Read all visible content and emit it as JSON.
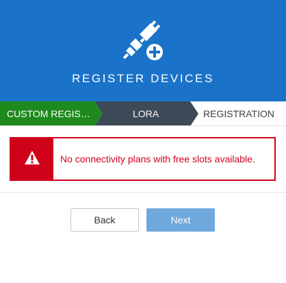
{
  "header": {
    "title": "REGISTER DEVICES",
    "icon": "plug-plus-icon",
    "background": "#1a73c9"
  },
  "steps": [
    {
      "label": "CUSTOM REGIST...",
      "state": "completed",
      "color": "#1e8a1e"
    },
    {
      "label": "LORA",
      "state": "active",
      "color": "#3d4a57"
    },
    {
      "label": "REGISTRATION",
      "state": "pending",
      "color": "#ffffff"
    }
  ],
  "alert": {
    "icon": "warning-icon",
    "message": "No connectivity plans with free slots available.",
    "color": "#d0021b"
  },
  "buttons": {
    "back_label": "Back",
    "next_label": "Next"
  }
}
